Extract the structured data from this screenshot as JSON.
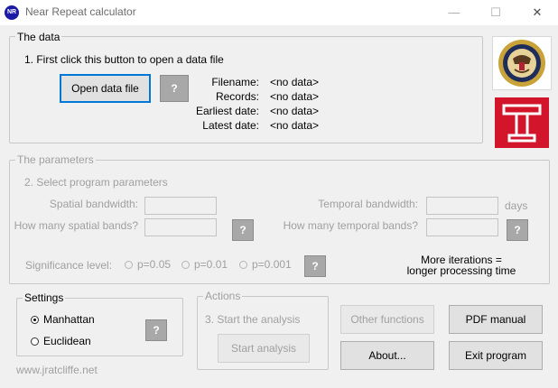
{
  "window": {
    "title": "Near Repeat calculator",
    "icon_text": "NR",
    "controls": [
      "minimize",
      "maximize",
      "close"
    ]
  },
  "data_section": {
    "legend": "The data",
    "instruction": "1. First click this button to open a data file",
    "open_button": "Open data file",
    "help_button": "?",
    "fields": [
      {
        "label": "Filename:",
        "value": "<no data>"
      },
      {
        "label": "Records:",
        "value": "<no data>"
      },
      {
        "label": "Earliest date:",
        "value": "<no data>"
      },
      {
        "label": "Latest date:",
        "value": "<no data>"
      }
    ]
  },
  "logos": {
    "doj": "doj-seal-logo",
    "temple": {
      "text": "T",
      "color": "#d2152b"
    }
  },
  "parameters": {
    "legend": "The parameters",
    "instruction": "2. Select program parameters",
    "spatial_bandwidth_label": "Spatial bandwidth:",
    "spatial_bands_label": "How many spatial bands?",
    "temporal_bandwidth_label": "Temporal bandwidth:",
    "temporal_bands_label": "How many temporal bands?",
    "days_label": "days",
    "spatial_bandwidth_value": "",
    "spatial_bands_value": "",
    "temporal_bandwidth_value": "",
    "temporal_bands_value": "",
    "help_button": "?",
    "significance_label": "Significance level:",
    "significance_options": [
      "p=0.05",
      "p=0.01",
      "p=0.001"
    ],
    "iterations_note_line1": "More iterations =",
    "iterations_note_line2": "longer processing time"
  },
  "settings": {
    "legend": "Settings",
    "options": [
      "Manhattan",
      "Euclidean"
    ],
    "selected": "Manhattan",
    "help_button": "?"
  },
  "actions": {
    "legend": "Actions",
    "instruction": "3. Start the analysis",
    "start_button": "Start analysis"
  },
  "buttons": {
    "other_functions": "Other functions",
    "pdf_manual": "PDF manual",
    "about": "About...",
    "exit": "Exit program"
  },
  "footer": {
    "url": "www.jratcliffe.net"
  },
  "colors": {
    "focus_border": "#0078d7",
    "temple_red": "#d2152b",
    "help_button_gray": "#a8a8a8"
  }
}
